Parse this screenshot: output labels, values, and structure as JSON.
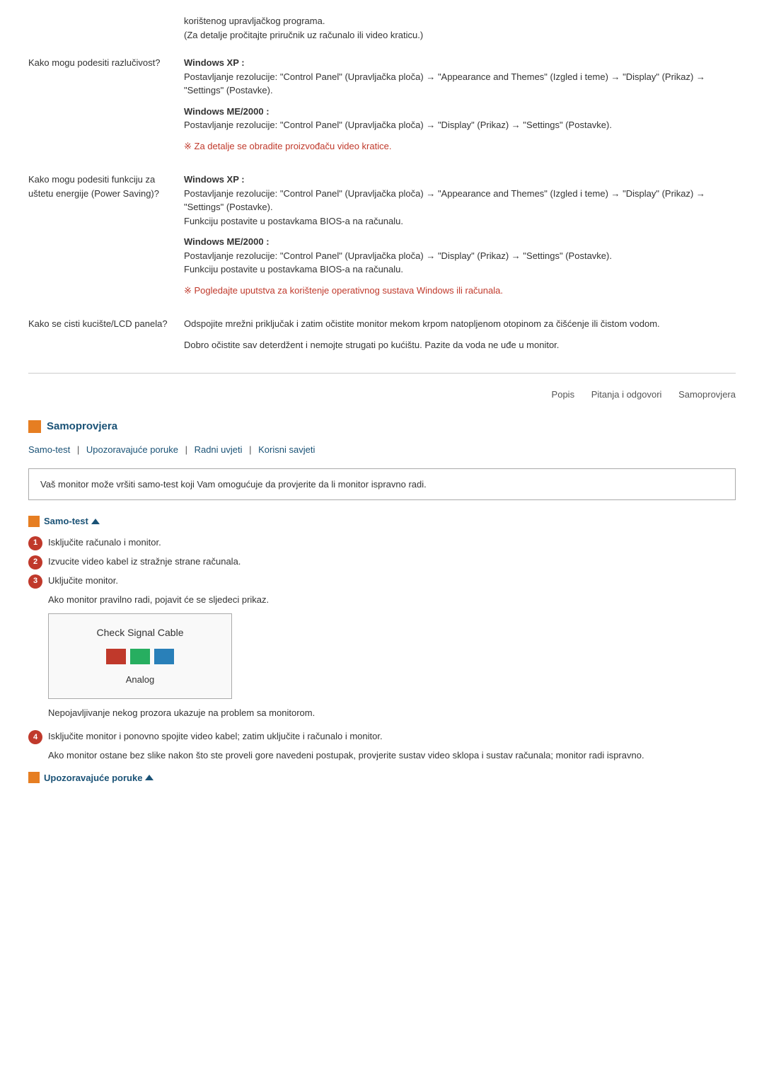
{
  "intro": {
    "line1": "korištenog upravljačkog programa.",
    "line2": "(Za detalje pročitajte priručnik uz računalo ili video kraticu.)"
  },
  "faq": [
    {
      "label": "Kako mogu podesiti razlučivost?",
      "blocks": [
        {
          "heading": "Windows XP :",
          "text": "Postavljanje rezolucije: \"Control Panel\" (Upravljačka ploča) → \"Appearance and Themes\" (Izgled i teme) → \"Display\" (Prikaz) → \"Settings\" (Postavke)."
        },
        {
          "heading": "Windows ME/2000 :",
          "text": "Postavljanje rezolucije: \"Control Panel\" (Upravljačka ploča) → \"Display\" (Prikaz) → \"Settings\" (Postavke)."
        },
        {
          "note": "※ Za detalje se obradite proizvođaču video kratice."
        }
      ]
    },
    {
      "label": "Kako mogu podesiti funkciju za uštetu energije (Power Saving)?",
      "blocks": [
        {
          "heading": "Windows XP :",
          "text": "Postavljanje rezolucije: \"Control Panel\" (Upravljačka ploča) → \"Appearance and Themes\" (Izgled i teme) → \"Display\" (Prikaz) → \"Settings\" (Postavke).\nFunkciju postavite u postavkama BIOS-a na računalu."
        },
        {
          "heading": "Windows ME/2000 :",
          "text": "Postavljanje rezolucije: \"Control Panel\" (Upravljačka ploča) → \"Display\" (Prikaz) → \"Settings\" (Postavke).\nFunkciju postavite u postavkama BIOS-a na računalu."
        },
        {
          "note": "※ Pogledajte uputstva za korištenje operativnog sustava Windows ili računala."
        }
      ]
    },
    {
      "label": "Kako se cisti kucište/LCD panela?",
      "blocks": [
        {
          "text": "Odspojite mrežni priključak i zatim očistite monitor mekom krpom natopljenom otopinom za čišćenje ili čistom vodom."
        },
        {
          "text": "Dobro očistite sav deterdžent i nemojte strugati po kućištu. Pazite da voda ne uđe u monitor."
        }
      ]
    }
  ],
  "nav_bottom": {
    "popis": "Popis",
    "pitanja": "Pitanja i odgovori",
    "samoprovjera": "Samoprovjera"
  },
  "samoprovjera": {
    "section_title": "Samoprovjera",
    "nav_links": [
      {
        "label": "Samo-test",
        "sep": " | "
      },
      {
        "label": "Upozoravajuće poruke",
        "sep": " | "
      },
      {
        "label": "Radni uvjeti",
        "sep": " | "
      },
      {
        "label": "Korisni savjeti",
        "sep": ""
      }
    ],
    "info_text": "Vaš monitor može vršiti samo-test koji Vam omogućuje da provjerite da li monitor ispravno radi.",
    "samo_test_label": "Samo-test",
    "steps": [
      {
        "num": "1",
        "text": "Isključite računalo i monitor."
      },
      {
        "num": "2",
        "text": "Izvucite video kabel iz stražnje strane računala."
      },
      {
        "num": "3",
        "text": "Uključite monitor.",
        "sub": "Ako monitor pravilno radi, pojavit će se sljedeci prikaz."
      }
    ],
    "signal_box": {
      "title": "Check Signal Cable",
      "sub": "Analog",
      "bars": [
        {
          "color": "#c0392b"
        },
        {
          "color": "#27ae60"
        },
        {
          "color": "#2980b9"
        }
      ]
    },
    "warning_text": "Nepojavljivanje nekog prozora ukazuje na problem sa monitorom.",
    "step4": {
      "num": "4",
      "text": "Isključite monitor i ponovno spojite video kabel; zatim uključite i računalo i monitor.",
      "sub": "Ako monitor ostane bez slike nakon što ste proveli gore navedeni postupak, provjerite sustav video sklopa i sustav računala; monitor radi ispravno."
    },
    "upozor_label": "Upozoravajuće poruke"
  }
}
